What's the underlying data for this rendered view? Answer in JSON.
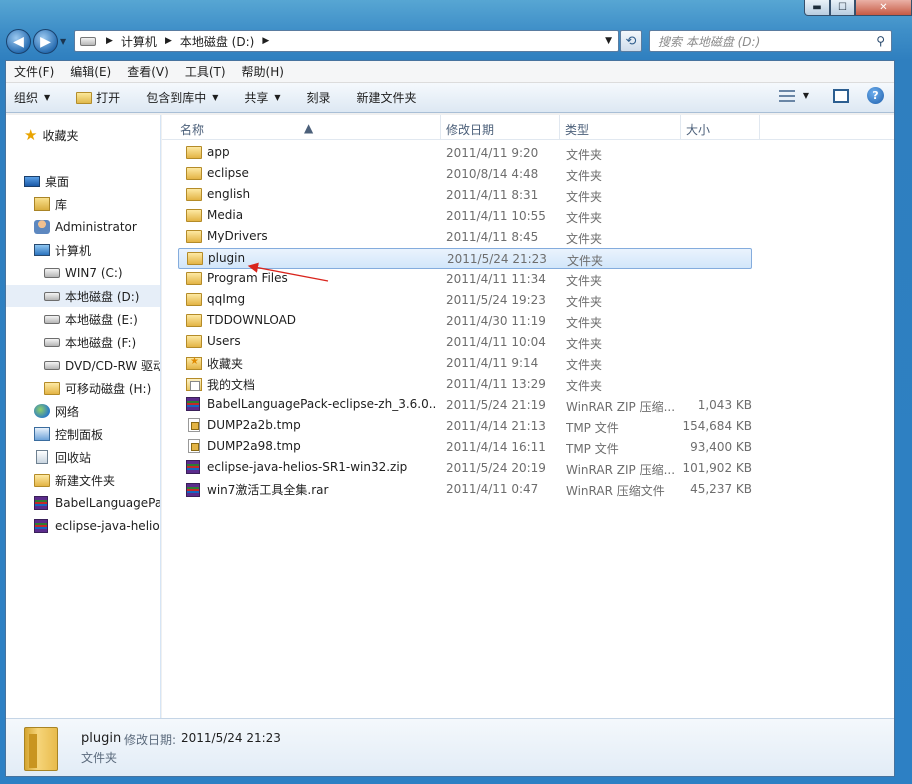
{
  "window": {
    "min_glyph": "▬",
    "max_glyph": "☐",
    "close_glyph": "✕"
  },
  "address": {
    "crumbs": [
      "计算机",
      "本地磁盘 (D:)"
    ],
    "search_placeholder": "搜索 本地磁盘 (D:)"
  },
  "menu": [
    "文件(F)",
    "编辑(E)",
    "查看(V)",
    "工具(T)",
    "帮助(H)"
  ],
  "toolbar": {
    "organize": "组织",
    "open": "打开",
    "include_library": "包含到库中",
    "share": "共享",
    "burn": "刻录",
    "new_folder": "新建文件夹"
  },
  "nav": {
    "favorites": "收藏夹",
    "desktop": "桌面",
    "library": "库",
    "admin": "Administrator",
    "computer": "计算机",
    "drive_c": "WIN7 (C:)",
    "drive_d": "本地磁盘 (D:)",
    "drive_e": "本地磁盘 (E:)",
    "drive_f": "本地磁盘 (F:)",
    "dvd": "DVD/CD-RW 驱动",
    "removable": "可移动磁盘 (H:)",
    "network": "网络",
    "control_panel": "控制面板",
    "recycle_bin": "回收站",
    "new_folder": "新建文件夹",
    "babel": "BabelLanguagePack",
    "eclipse": "eclipse-java-helios"
  },
  "columns": {
    "name": "名称",
    "date": "修改日期",
    "type": "类型",
    "size": "大小"
  },
  "files": [
    {
      "name": "app",
      "date": "2011/4/11 9:20",
      "type": "文件夹",
      "size": "",
      "icon": "folder"
    },
    {
      "name": "eclipse",
      "date": "2010/8/14 4:48",
      "type": "文件夹",
      "size": "",
      "icon": "folder"
    },
    {
      "name": "english",
      "date": "2011/4/11 8:31",
      "type": "文件夹",
      "size": "",
      "icon": "folder"
    },
    {
      "name": "Media",
      "date": "2011/4/11 10:55",
      "type": "文件夹",
      "size": "",
      "icon": "folder"
    },
    {
      "name": "MyDrivers",
      "date": "2011/4/11 8:45",
      "type": "文件夹",
      "size": "",
      "icon": "folder"
    },
    {
      "name": "plugin",
      "date": "2011/5/24 21:23",
      "type": "文件夹",
      "size": "",
      "icon": "folder"
    },
    {
      "name": "Program Files",
      "date": "2011/4/11 11:34",
      "type": "文件夹",
      "size": "",
      "icon": "folder"
    },
    {
      "name": "qqImg",
      "date": "2011/5/24 19:23",
      "type": "文件夹",
      "size": "",
      "icon": "folder"
    },
    {
      "name": "TDDOWNLOAD",
      "date": "2011/4/30 11:19",
      "type": "文件夹",
      "size": "",
      "icon": "folder"
    },
    {
      "name": "Users",
      "date": "2011/4/11 10:04",
      "type": "文件夹",
      "size": "",
      "icon": "folder"
    },
    {
      "name": "收藏夹",
      "date": "2011/4/11 9:14",
      "type": "文件夹",
      "size": "",
      "icon": "fav"
    },
    {
      "name": "我的文档",
      "date": "2011/4/11 13:29",
      "type": "文件夹",
      "size": "",
      "icon": "docs"
    },
    {
      "name": "BabelLanguagePack-eclipse-zh_3.6.0....",
      "date": "2011/5/24 21:19",
      "type": "WinRAR ZIP 压缩...",
      "size": "1,043 KB",
      "icon": "rar"
    },
    {
      "name": "DUMP2a2b.tmp",
      "date": "2011/4/14 21:13",
      "type": "TMP 文件",
      "size": "154,684 KB",
      "icon": "tmp"
    },
    {
      "name": "DUMP2a98.tmp",
      "date": "2011/4/14 16:11",
      "type": "TMP 文件",
      "size": "93,400 KB",
      "icon": "tmp"
    },
    {
      "name": "eclipse-java-helios-SR1-win32.zip",
      "date": "2011/5/24 20:19",
      "type": "WinRAR ZIP 压缩...",
      "size": "101,902 KB",
      "icon": "rar"
    },
    {
      "name": "win7激活工具全集.rar",
      "date": "2011/4/11 0:47",
      "type": "WinRAR 压缩文件",
      "size": "45,237 KB",
      "icon": "rar"
    }
  ],
  "details": {
    "name": "plugin",
    "date_label": "修改日期:",
    "date": "2011/5/24 21:23",
    "type": "文件夹"
  },
  "colors": {
    "selection_border": "#84acdd",
    "annotation_arrow": "#d9241c"
  }
}
